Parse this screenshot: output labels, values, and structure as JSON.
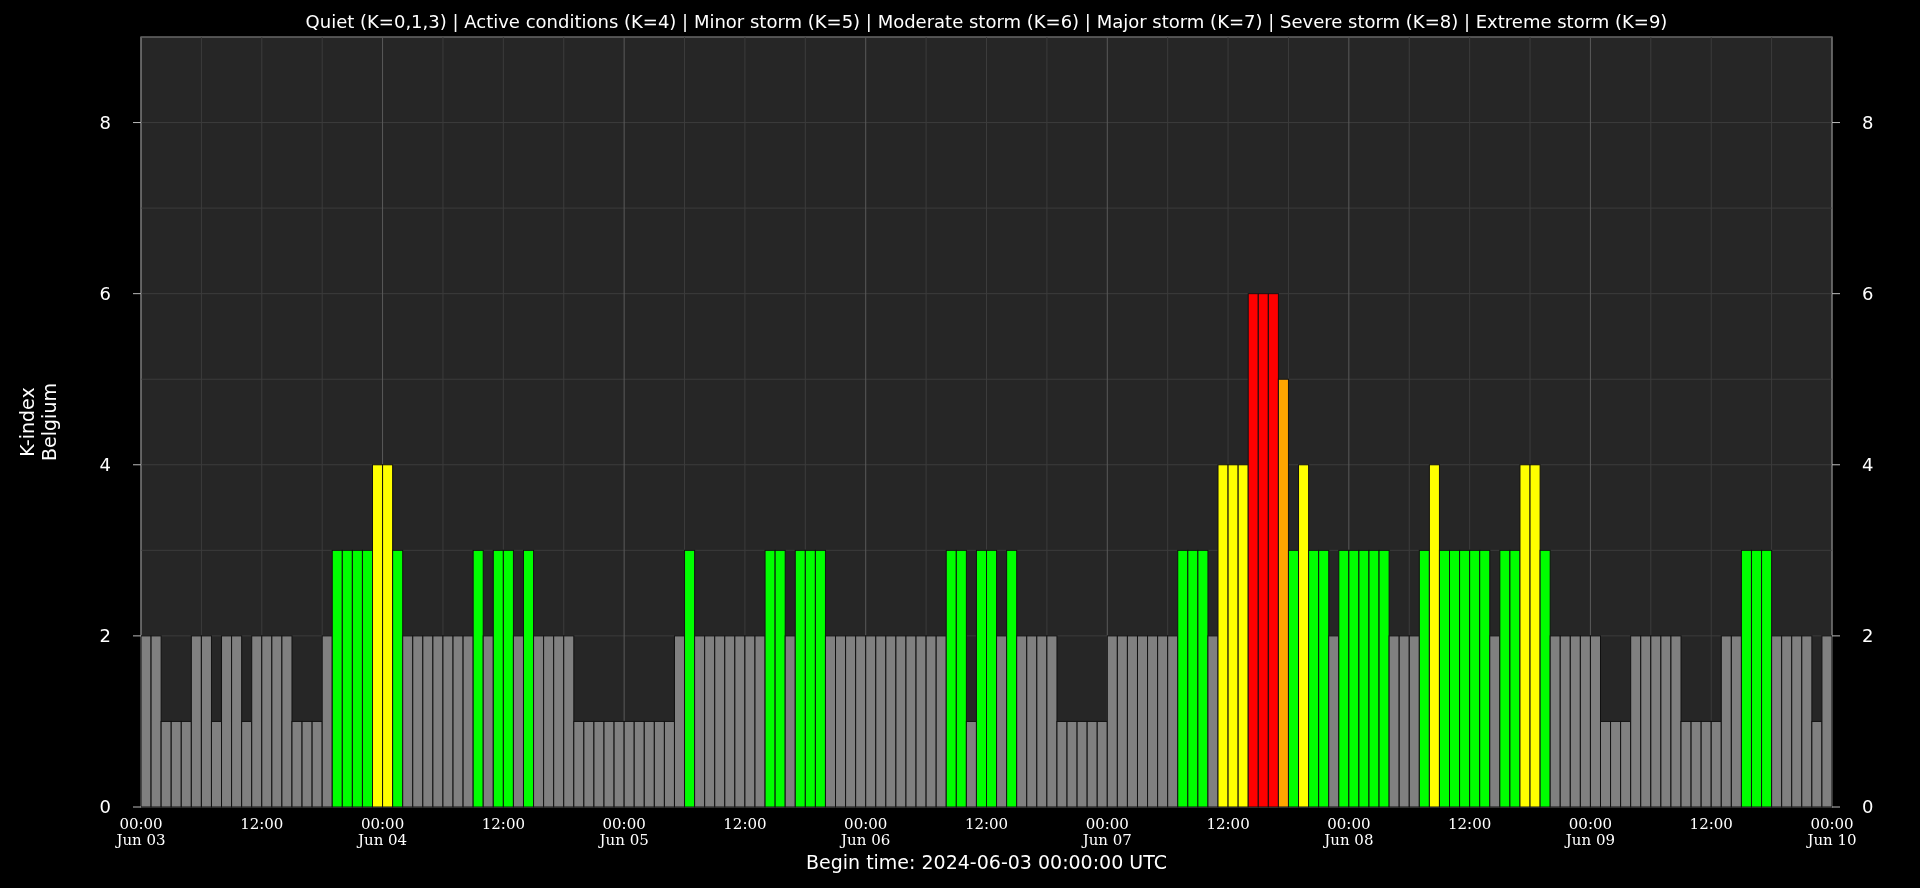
{
  "chart_data": {
    "type": "bar",
    "grid": true,
    "x": [
      "2024-06-03T00:30Z",
      "2024-06-03T01:30Z",
      "2024-06-03T02:30Z",
      "2024-06-03T03:30Z",
      "2024-06-03T04:30Z",
      "2024-06-03T05:30Z",
      "2024-06-03T06:30Z",
      "2024-06-03T07:30Z",
      "2024-06-03T08:30Z",
      "2024-06-03T09:30Z",
      "2024-06-03T10:30Z",
      "2024-06-03T11:30Z",
      "2024-06-03T12:30Z",
      "2024-06-03T13:30Z",
      "2024-06-03T14:30Z",
      "2024-06-03T15:30Z",
      "2024-06-03T16:30Z",
      "2024-06-03T17:30Z",
      "2024-06-03T18:30Z",
      "2024-06-03T19:30Z",
      "2024-06-03T20:30Z",
      "2024-06-03T21:30Z",
      "2024-06-03T22:30Z",
      "2024-06-03T23:30Z",
      "2024-06-04T00:30Z",
      "2024-06-04T01:30Z",
      "2024-06-04T02:30Z",
      "2024-06-04T03:30Z",
      "2024-06-04T04:30Z",
      "2024-06-04T05:30Z",
      "2024-06-04T06:30Z",
      "2024-06-04T07:30Z",
      "2024-06-04T08:30Z",
      "2024-06-04T09:30Z",
      "2024-06-04T10:30Z",
      "2024-06-04T11:30Z",
      "2024-06-04T12:30Z",
      "2024-06-04T13:30Z",
      "2024-06-04T14:30Z",
      "2024-06-04T15:30Z",
      "2024-06-04T16:30Z",
      "2024-06-04T17:30Z",
      "2024-06-04T18:30Z",
      "2024-06-04T19:30Z",
      "2024-06-04T20:30Z",
      "2024-06-04T21:30Z",
      "2024-06-04T22:30Z",
      "2024-06-04T23:30Z",
      "2024-06-05T00:30Z",
      "2024-06-05T01:30Z",
      "2024-06-05T02:30Z",
      "2024-06-05T03:30Z",
      "2024-06-05T04:30Z",
      "2024-06-05T05:30Z",
      "2024-06-05T06:30Z",
      "2024-06-05T07:30Z",
      "2024-06-05T08:30Z",
      "2024-06-05T09:30Z",
      "2024-06-05T10:30Z",
      "2024-06-05T11:30Z",
      "2024-06-05T12:30Z",
      "2024-06-05T13:30Z",
      "2024-06-05T14:30Z",
      "2024-06-05T15:30Z",
      "2024-06-05T16:30Z",
      "2024-06-05T17:30Z",
      "2024-06-05T18:30Z",
      "2024-06-05T19:30Z",
      "2024-06-05T20:30Z",
      "2024-06-05T21:30Z",
      "2024-06-05T22:30Z",
      "2024-06-05T23:30Z",
      "2024-06-06T00:30Z",
      "2024-06-06T01:30Z",
      "2024-06-06T02:30Z",
      "2024-06-06T03:30Z",
      "2024-06-06T04:30Z",
      "2024-06-06T05:30Z",
      "2024-06-06T06:30Z",
      "2024-06-06T07:30Z",
      "2024-06-06T08:30Z",
      "2024-06-06T09:30Z",
      "2024-06-06T10:30Z",
      "2024-06-06T11:30Z",
      "2024-06-06T12:30Z",
      "2024-06-06T13:30Z",
      "2024-06-06T14:30Z",
      "2024-06-06T15:30Z",
      "2024-06-06T16:30Z",
      "2024-06-06T17:30Z",
      "2024-06-06T18:30Z",
      "2024-06-06T19:30Z",
      "2024-06-06T20:30Z",
      "2024-06-06T21:30Z",
      "2024-06-06T22:30Z",
      "2024-06-06T23:30Z",
      "2024-06-07T00:30Z",
      "2024-06-07T01:30Z",
      "2024-06-07T02:30Z",
      "2024-06-07T03:30Z",
      "2024-06-07T04:30Z",
      "2024-06-07T05:30Z",
      "2024-06-07T06:30Z",
      "2024-06-07T07:30Z",
      "2024-06-07T08:30Z",
      "2024-06-07T09:30Z",
      "2024-06-07T10:30Z",
      "2024-06-07T11:30Z",
      "2024-06-07T12:30Z",
      "2024-06-07T13:30Z",
      "2024-06-07T14:30Z",
      "2024-06-07T15:30Z",
      "2024-06-07T16:30Z",
      "2024-06-07T17:30Z",
      "2024-06-07T18:30Z",
      "2024-06-07T19:30Z",
      "2024-06-07T20:30Z",
      "2024-06-07T21:30Z",
      "2024-06-07T22:30Z",
      "2024-06-07T23:30Z",
      "2024-06-08T00:30Z",
      "2024-06-08T01:30Z",
      "2024-06-08T02:30Z",
      "2024-06-08T03:30Z",
      "2024-06-08T04:30Z",
      "2024-06-08T05:30Z",
      "2024-06-08T06:30Z",
      "2024-06-08T07:30Z",
      "2024-06-08T08:30Z",
      "2024-06-08T09:30Z",
      "2024-06-08T10:30Z",
      "2024-06-08T11:30Z",
      "2024-06-08T12:30Z",
      "2024-06-08T13:30Z",
      "2024-06-08T14:30Z",
      "2024-06-08T15:30Z",
      "2024-06-08T16:30Z",
      "2024-06-08T17:30Z",
      "2024-06-08T18:30Z",
      "2024-06-08T19:30Z",
      "2024-06-08T20:30Z",
      "2024-06-08T21:30Z",
      "2024-06-08T22:30Z",
      "2024-06-08T23:30Z",
      "2024-06-09T00:30Z",
      "2024-06-09T01:30Z",
      "2024-06-09T02:30Z",
      "2024-06-09T03:30Z",
      "2024-06-09T04:30Z",
      "2024-06-09T05:30Z",
      "2024-06-09T06:30Z",
      "2024-06-09T07:30Z",
      "2024-06-09T08:30Z",
      "2024-06-09T09:30Z",
      "2024-06-09T10:30Z",
      "2024-06-09T11:30Z",
      "2024-06-09T12:30Z",
      "2024-06-09T13:30Z",
      "2024-06-09T14:30Z",
      "2024-06-09T15:30Z",
      "2024-06-09T16:30Z",
      "2024-06-09T17:30Z",
      "2024-06-09T18:30Z",
      "2024-06-09T19:30Z",
      "2024-06-09T20:30Z",
      "2024-06-09T21:30Z",
      "2024-06-09T22:30Z",
      "2024-06-09T23:30Z"
    ],
    "title": "Quiet (K=0,1,3) | Active conditions (K=4) | Minor storm (K=5) | Moderate storm (K=6) | Major storm (K=7) | Severe storm (K=8) | Extreme storm (K=9)",
    "xlabel": "Begin time: 2024-06-03 00:00:00 UTC",
    "ylabel": [
      "K-index",
      "Belgium"
    ],
    "xlim": [
      "2024-06-03T00:00Z",
      "2024-06-10T00:00Z"
    ],
    "ylim": [
      0,
      9
    ],
    "values": [
      2,
      2,
      1,
      1,
      1,
      2,
      2,
      1,
      2,
      2,
      1,
      2,
      2,
      2,
      2,
      1,
      1,
      1,
      2,
      3,
      3,
      3,
      3,
      4,
      4,
      3,
      2,
      2,
      2,
      2,
      2,
      2,
      2,
      3,
      2,
      3,
      3,
      2,
      3,
      2,
      2,
      2,
      2,
      1,
      1,
      1,
      1,
      1,
      1,
      1,
      1,
      1,
      1,
      2,
      3,
      2,
      2,
      2,
      2,
      2,
      2,
      2,
      3,
      3,
      2,
      3,
      3,
      3,
      2,
      2,
      2,
      2,
      2,
      2,
      2,
      2,
      2,
      2,
      2,
      2,
      3,
      3,
      1,
      3,
      3,
      2,
      3,
      2,
      2,
      2,
      2,
      1,
      1,
      1,
      1,
      1,
      2,
      2,
      2,
      2,
      2,
      2,
      2,
      3,
      3,
      3,
      2,
      4,
      4,
      4,
      6,
      6,
      6,
      5,
      3,
      4,
      3,
      3,
      2,
      3,
      3,
      3,
      3,
      3,
      2,
      2,
      2,
      3,
      4,
      3,
      3,
      3,
      3,
      3,
      2,
      3,
      3,
      4,
      4,
      3,
      2,
      2,
      2,
      2,
      2,
      1,
      1,
      1,
      2,
      2,
      2,
      2,
      2,
      1,
      1,
      1,
      1,
      2,
      2,
      3,
      3,
      3,
      2,
      2,
      2,
      2,
      1,
      2
    ],
    "xticks": [
      {
        "value": "2024-06-03T00:00Z",
        "label": "00:00"
      },
      {
        "value": "2024-06-03T12:00Z",
        "label": "12:00"
      },
      {
        "value": "2024-06-04T00:00Z",
        "label": "00:00"
      },
      {
        "value": "2024-06-04T12:00Z",
        "label": "12:00"
      },
      {
        "value": "2024-06-05T00:00Z",
        "label": "00:00"
      },
      {
        "value": "2024-06-05T12:00Z",
        "label": "12:00"
      },
      {
        "value": "2024-06-06T00:00Z",
        "label": "00:00"
      },
      {
        "value": "2024-06-06T12:00Z",
        "label": "12:00"
      },
      {
        "value": "2024-06-07T00:00Z",
        "label": "00:00"
      },
      {
        "value": "2024-06-07T12:00Z",
        "label": "12:00"
      },
      {
        "value": "2024-06-08T00:00Z",
        "label": "00:00"
      },
      {
        "value": "2024-06-08T12:00Z",
        "label": "12:00"
      },
      {
        "value": "2024-06-09T00:00Z",
        "label": "00:00"
      },
      {
        "value": "2024-06-09T12:00Z",
        "label": "12:00"
      },
      {
        "value": "2024-06-10T00:00Z",
        "label": "00:00"
      }
    ],
    "yticks": [
      0,
      2,
      4,
      6,
      8
    ],
    "annotations": [
      "8",
      "6",
      "4",
      "2",
      "0"
    ]
  },
  "x_axis_dates": [
    "Jun 03",
    "Jun 04",
    "Jun 05",
    "Jun 06",
    "Jun 07",
    "Jun 08",
    "Jun 09",
    "Jun 10"
  ]
}
